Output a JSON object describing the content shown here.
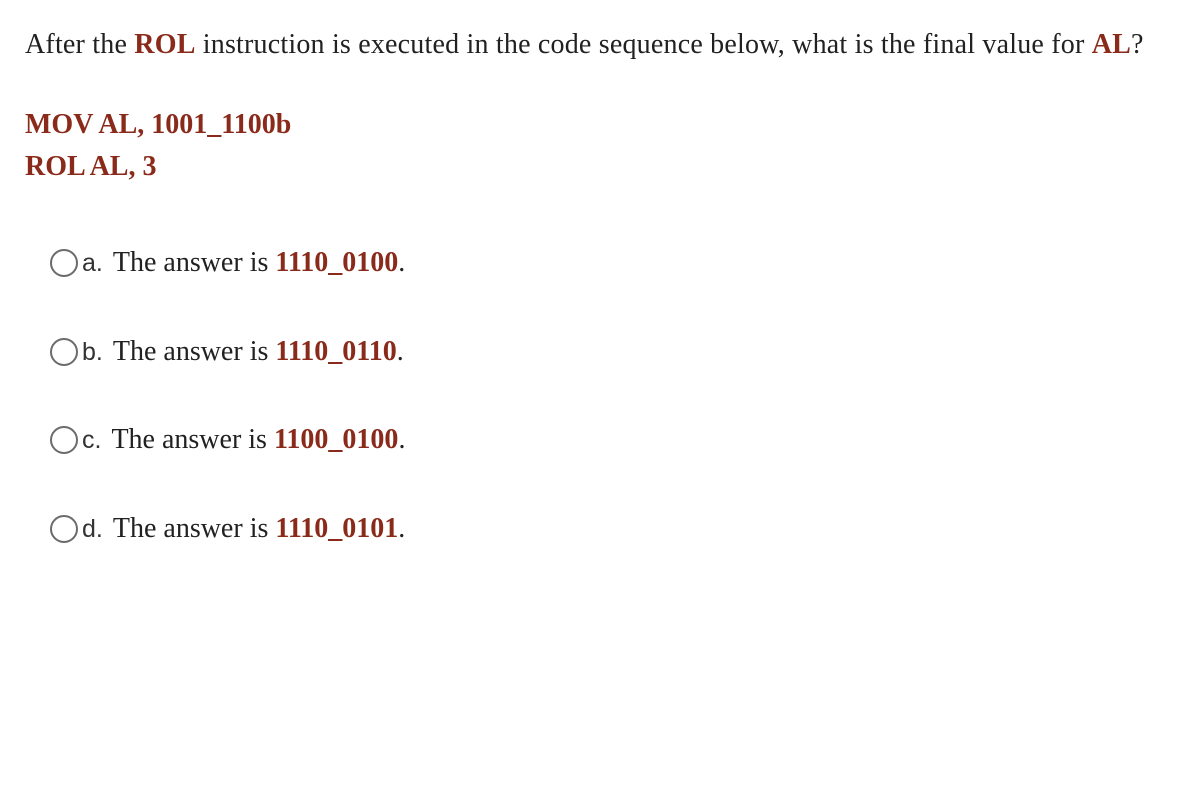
{
  "question": {
    "prefix": "After the ",
    "instr": "ROL",
    "mid": " instruction is executed in the code sequence below, what is the final value for ",
    "reg": "AL",
    "suffix": "?"
  },
  "code": {
    "line1": "MOV AL, 1001_1100b",
    "line2": "ROL AL, 3"
  },
  "options": [
    {
      "letter": "a.",
      "lead": "The answer is ",
      "value": "1110_0100",
      "tail": "."
    },
    {
      "letter": "b.",
      "lead": "The answer is ",
      "value": "1110_0110",
      "tail": "."
    },
    {
      "letter": "c.",
      "lead": "The answer is ",
      "value": "1100_0100",
      "tail": "."
    },
    {
      "letter": "d.",
      "lead": "The answer is ",
      "value": "1110_0101",
      "tail": "."
    }
  ]
}
